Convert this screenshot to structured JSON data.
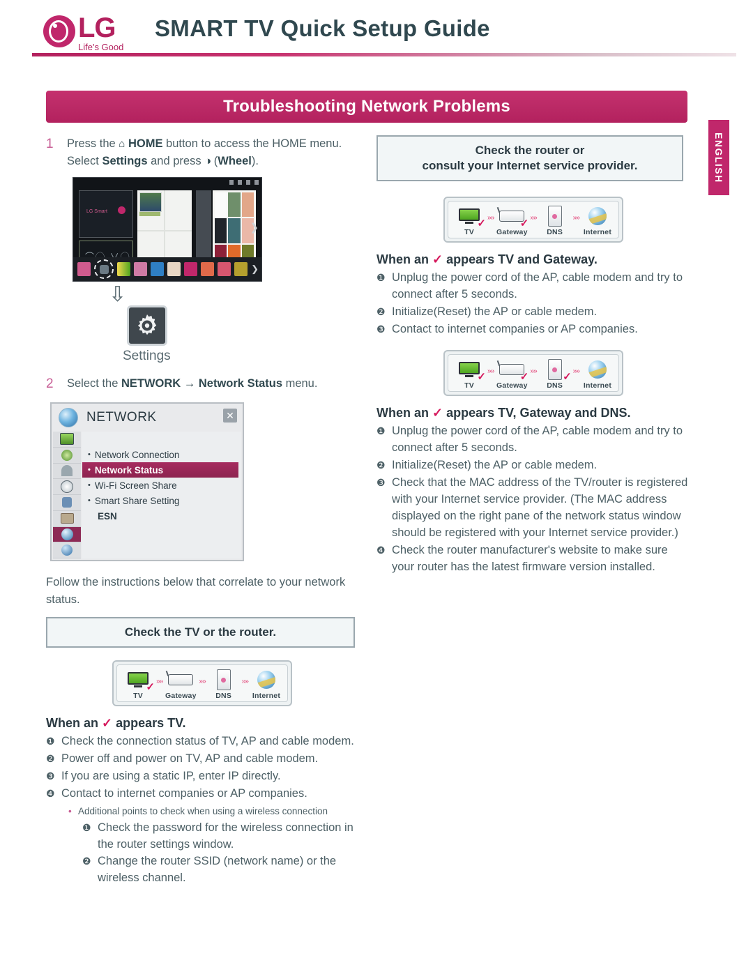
{
  "header": {
    "brand": "LG",
    "slogan": "Life's Good",
    "title": "SMART TV Quick Setup Guide",
    "side_tab": "ENGLISH"
  },
  "section": {
    "banner": "Troubleshooting Network Problems",
    "banner_color": "#b3215e"
  },
  "left": {
    "step1": {
      "num": "1",
      "text_a": "Press the ",
      "home_icon": "⌂",
      "bold_home": "HOME",
      "text_b": " button to access the HOME menu. Select ",
      "bold_settings": "Settings",
      "text_c": " and press ",
      "wheel_icon": "◑",
      "text_d": " (",
      "bold_wheel": "Wheel",
      "text_e": ")."
    },
    "settings_label": "Settings",
    "down_arrow": "⇩",
    "step2": {
      "num": "2",
      "text_a": "Select the ",
      "bold_network": "NETWORK",
      "arrow": " → ",
      "bold_status": "Network Status",
      "text_b": " menu."
    },
    "network_menu": {
      "title": "NETWORK",
      "close": "✕",
      "items": [
        {
          "label": "Network Connection",
          "selected": false
        },
        {
          "label": "Network Status",
          "selected": true
        },
        {
          "label": "Wi-Fi Screen Share",
          "selected": false
        },
        {
          "label": "Smart Share Setting",
          "selected": false
        }
      ],
      "esn": "ESN"
    },
    "follow_text": "Follow the instructions below that correlate to your network status.",
    "callout": "Check the TV or the router.",
    "diagram": {
      "nodes": [
        {
          "label": "TV",
          "icon": "tv-icon",
          "check": true
        },
        {
          "label": "Gateway",
          "icon": "router-icon",
          "check": false
        },
        {
          "label": "DNS",
          "icon": "dns-server-icon",
          "check": false
        },
        {
          "label": "Internet",
          "icon": "globe-icon",
          "check": false
        }
      ],
      "link_glyph": "››››"
    },
    "when_head": {
      "pre": "When an ",
      "check": "✓",
      "post": " appears TV."
    },
    "items": [
      {
        "mk": "❶",
        "text": "Check the connection status of TV, AP and cable modem."
      },
      {
        "mk": "❷",
        "text": "Power off and power on TV, AP and cable modem."
      },
      {
        "mk": "❸",
        "text": "If you are using a static IP, enter IP directly."
      },
      {
        "mk": "❹",
        "text": "Contact to internet companies or AP companies."
      }
    ],
    "sub_bullet": {
      "mark": "•",
      "text": "Additional points to check when using a wireless connection"
    },
    "sub_items": [
      {
        "mk": "❶",
        "text": "Check the password for the wireless connection in the router settings window."
      },
      {
        "mk": "❷",
        "text": "Change the router SSID (network name) or the wireless channel."
      }
    ]
  },
  "right": {
    "callout_line1": "Check the router or",
    "callout_line2": "consult your Internet service provider.",
    "diagram1": {
      "nodes": [
        {
          "label": "TV",
          "icon": "tv-icon",
          "check": true
        },
        {
          "label": "Gateway",
          "icon": "router-icon",
          "check": true
        },
        {
          "label": "DNS",
          "icon": "dns-server-icon",
          "check": false
        },
        {
          "label": "Internet",
          "icon": "globe-icon",
          "check": false
        }
      ],
      "link_glyph": "››››"
    },
    "when_head1": {
      "pre": "When an ",
      "check": "✓",
      "post": " appears TV and Gateway."
    },
    "items1": [
      {
        "mk": "❶",
        "text": "Unplug the power cord of the AP, cable modem and try to connect after 5 seconds."
      },
      {
        "mk": "❷",
        "text": "Initialize(Reset) the AP or cable medem."
      },
      {
        "mk": "❸",
        "text": "Contact to internet companies or AP companies."
      }
    ],
    "diagram2": {
      "nodes": [
        {
          "label": "TV",
          "icon": "tv-icon",
          "check": true
        },
        {
          "label": "Gateway",
          "icon": "router-icon",
          "check": true
        },
        {
          "label": "DNS",
          "icon": "dns-server-icon",
          "check": true
        },
        {
          "label": "Internet",
          "icon": "globe-icon",
          "check": false
        }
      ],
      "link_glyph": "››››"
    },
    "when_head2": {
      "pre": "When an ",
      "check": "✓",
      "post": " appears TV, Gateway and DNS."
    },
    "items2": [
      {
        "mk": "❶",
        "text": "Unplug the power cord of the AP, cable modem and try to connect after 5 seconds."
      },
      {
        "mk": "❷",
        "text": "Initialize(Reset) the AP or cable medem."
      },
      {
        "mk": "❸",
        "text": "Check that the MAC address of the TV/router is registered with your Internet service provider. (The MAC address displayed on the right pane of the network status window should be registered with your Internet service provider.)"
      },
      {
        "mk": "❹",
        "text": "Check the router manufacturer's website to make sure your router has the latest firmware version installed."
      }
    ]
  }
}
